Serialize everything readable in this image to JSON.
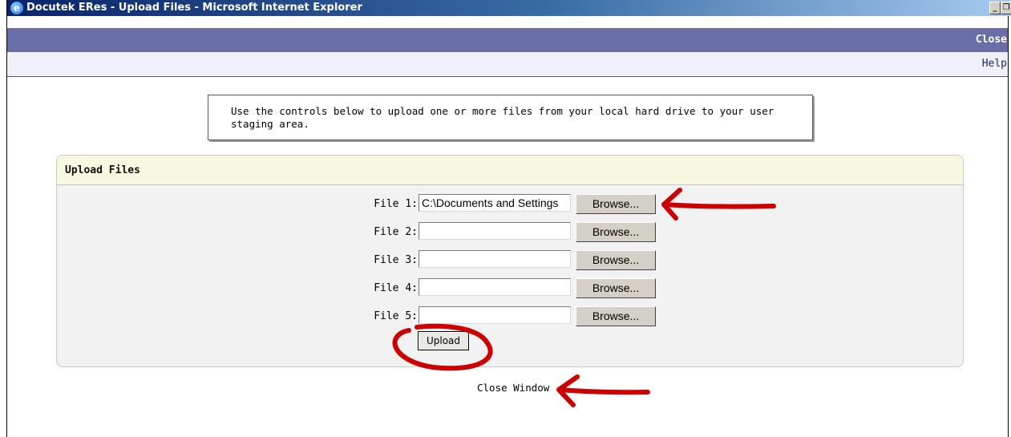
{
  "window": {
    "title": "Docutek ERes - Upload Files - Microsoft Internet Explorer",
    "minimize_glyph": "_",
    "restore_glyph": "❐"
  },
  "header": {
    "close_label": "Close",
    "help_label": "Help"
  },
  "instructions": "Use the controls below to upload one or more files from your local hard drive to your user staging area.",
  "upload_panel": {
    "heading": "Upload Files",
    "files": [
      {
        "label": "File 1:",
        "value": "C:\\Documents and Settings",
        "browse_label": "Browse..."
      },
      {
        "label": "File 2:",
        "value": "",
        "browse_label": "Browse..."
      },
      {
        "label": "File 3:",
        "value": "",
        "browse_label": "Browse..."
      },
      {
        "label": "File 4:",
        "value": "",
        "browse_label": "Browse..."
      },
      {
        "label": "File 5:",
        "value": "",
        "browse_label": "Browse..."
      }
    ],
    "upload_label": "Upload"
  },
  "footer": {
    "close_window_label": "Close Window"
  },
  "colors": {
    "header_bar": "#6a6ea8",
    "panel_head": "#f8f7e0",
    "annotation": "#cc0000"
  }
}
